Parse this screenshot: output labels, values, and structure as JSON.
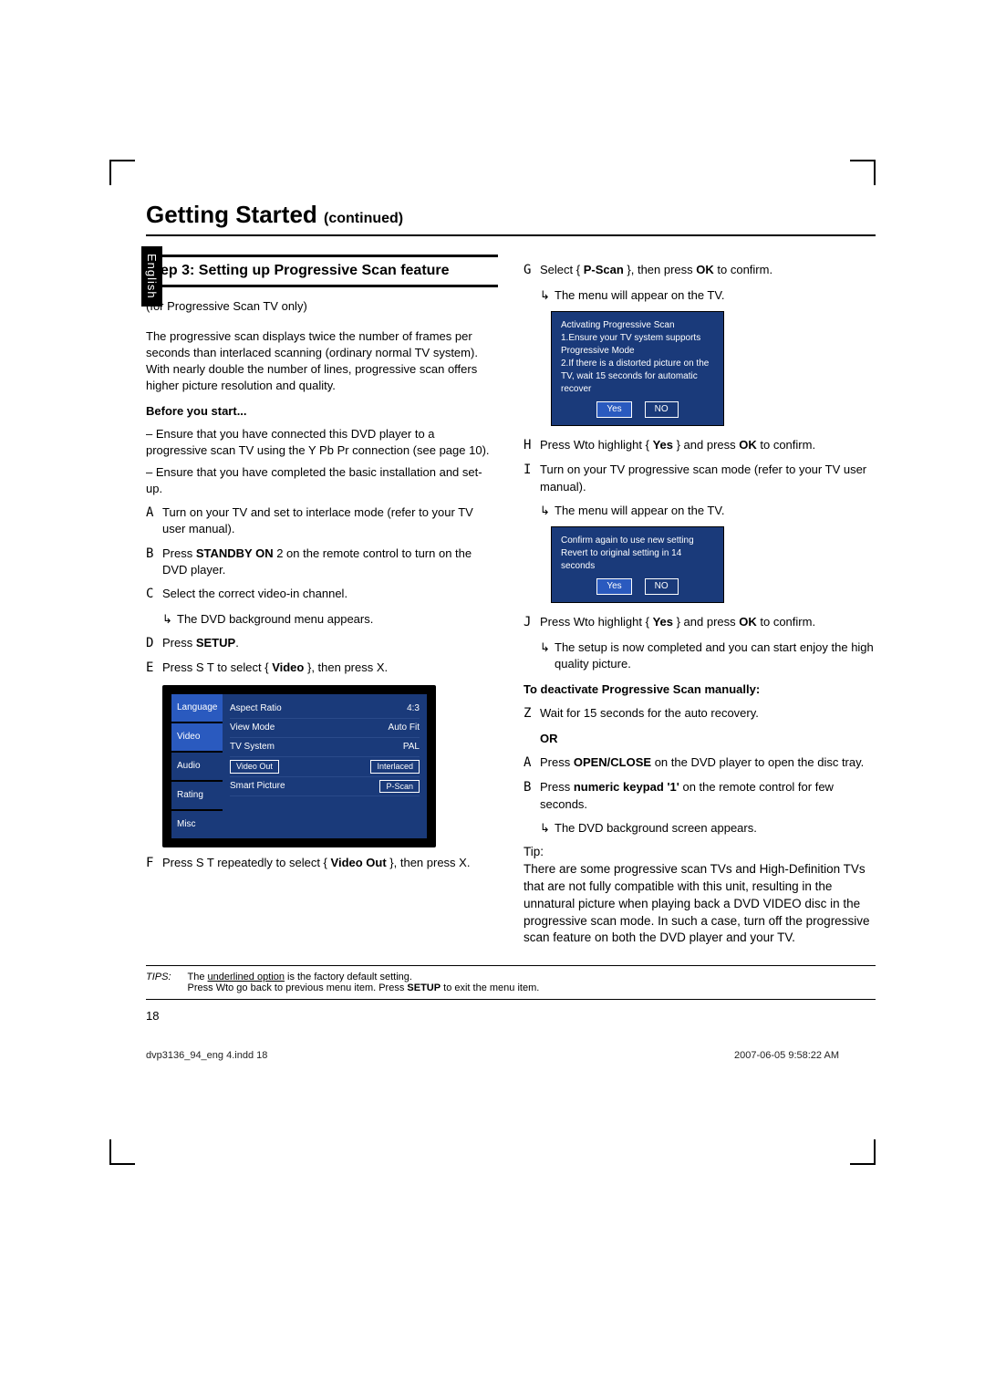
{
  "header": {
    "title": "Getting Started",
    "continued": "(continued)"
  },
  "lang_tab": "English",
  "left": {
    "step_head": "Step 3:  Setting up Progressive Scan feature",
    "intro_line": "(for Progressive Scan TV only)",
    "intro_body": "The progressive scan displays twice the number of frames per seconds than interlaced scanning (ordinary normal TV system). With nearly double the number of lines, progressive scan offers higher picture resolution and quality.",
    "before_head": "Before you start...",
    "before_1": "– Ensure that you have connected this DVD player to a progressive scan TV using the Y Pb Pr connection (see page 10).",
    "before_2": "– Ensure that you have completed the basic installation and set-up.",
    "A": "Turn on your TV and set to interlace mode (refer to your TV user manual).",
    "B_pre": "Press ",
    "B_bold": "STANDBY ON",
    "B_post": " 2   on the remote control to turn on the DVD player.",
    "C": "Select the correct video-in channel.",
    "C_sub": "The DVD background menu appears.",
    "D_pre": "Press ",
    "D_bold": "SETUP",
    "D_post": ".",
    "E_pre": "Press   S T  to select { ",
    "E_bold": "Video",
    "E_post": " }, then press X.",
    "F_pre": "Press   S T  repeatedly to select { ",
    "F_bold": "Video Out",
    "F_post": " }, then press   X."
  },
  "menu": {
    "tabs": [
      "Language",
      "Video",
      "Audio",
      "Rating",
      "Misc"
    ],
    "items": [
      {
        "label": "Aspect Ratio",
        "value": "4:3"
      },
      {
        "label": "View Mode",
        "value": "Auto Fit"
      },
      {
        "label": "TV System",
        "value": "PAL"
      },
      {
        "label": "Video Out",
        "value": "Interlaced",
        "boxed": true
      },
      {
        "label": "Smart Picture",
        "value": "P-Scan",
        "boxed": true
      }
    ]
  },
  "right": {
    "G_pre": "Select { ",
    "G_bold": "P-Scan",
    "G_mid": " }, then press ",
    "G_bold2": "OK",
    "G_post": " to confirm.",
    "G_sub": "The menu will appear on the TV.",
    "dialog1_lines": [
      "Activating Progressive Scan",
      "1.Ensure your TV system supports Progressive Mode",
      "2.If there is a distorted picture on the TV, wait 15 seconds for automatic recover"
    ],
    "dialog1_yes": "Yes",
    "dialog1_no": "NO",
    "H_pre": "Press   Wto highlight { ",
    "H_bold": "Yes",
    "H_mid": " } and press ",
    "H_bold2": "OK",
    "H_post": " to confirm.",
    "I": "Turn on your TV progressive scan mode (refer to your TV user manual).",
    "I_sub": "The menu will appear on the TV.",
    "dialog2_lines": [
      "Confirm again to use new setting",
      "Revert to original setting in 14 seconds"
    ],
    "dialog2_yes": "Yes",
    "dialog2_no": "NO",
    "J_pre": "Press   Wto highlight { ",
    "J_bold": "Yes",
    "J_mid": " } and press ",
    "J_bold2": "OK",
    "J_post": " to confirm.",
    "J_sub": "The setup is now completed and you can start enjoy the high quality picture.",
    "deact_head": "To deactivate Progressive Scan manually:",
    "Z": "Wait for 15 seconds for the auto recovery.",
    "OR": "OR",
    "A2_pre": "Press ",
    "A2_bold": "OPEN/CLOSE",
    "A2_post": "       on the DVD player to open the disc tray.",
    "B2_pre": "Press ",
    "B2_bold": "numeric keypad '1'",
    "B2_post": " on the remote control for few seconds.",
    "B2_sub": "The DVD background screen appears.",
    "tip_label": "Tip:",
    "tip_body": " There are some progressive scan TVs and High-Definition TVs that are not fully compatible with this unit, resulting in the unnatural picture when playing back a DVD VIDEO disc in the progressive scan mode. In such a case, turn off the progressive scan feature on both the DVD player and your TV."
  },
  "tips": {
    "label": "TIPS:",
    "line1_pre": "The ",
    "line1_u": "underlined option",
    "line1_post": " is the factory default setting.",
    "line2_pre": "Press   Wto go back to previous menu item. Press ",
    "line2_bold": "SETUP",
    "line2_post": " to exit the menu item."
  },
  "page_number": "18",
  "footer": {
    "left": "dvp3136_94_eng 4.indd   18",
    "right": "2007-06-05   9:58:22 AM"
  }
}
